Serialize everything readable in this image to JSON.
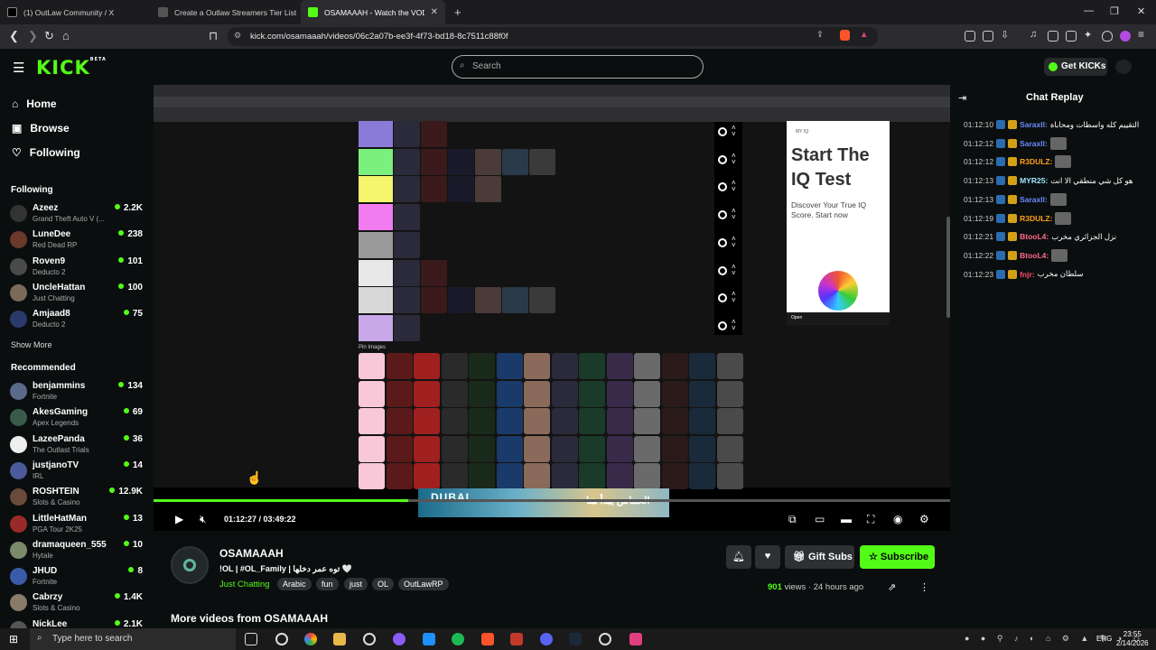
{
  "browser": {
    "tabs": [
      {
        "label": "(1) OutLaw Community / X",
        "fav": "#000000"
      },
      {
        "label": "Create a Outlaw Streamers Tier List -",
        "fav": "#555555"
      },
      {
        "label": "OSAMAAAH - Watch the VOD o",
        "fav": "#53fc18"
      }
    ],
    "new_tab": "+",
    "url": "kick.com/osamaaah/videos/06c2a07b-ee3f-4f73-bd18-8c7511c88f0f"
  },
  "header": {
    "logo": "KICK",
    "logo_badge": "BETA",
    "search_placeholder": "Search",
    "get_kicks": "Get KICKs"
  },
  "sidebar": {
    "nav": [
      {
        "label": "Home",
        "icon": "home-icon"
      },
      {
        "label": "Browse",
        "icon": "browse-icon"
      },
      {
        "label": "Following",
        "icon": "heart-icon"
      }
    ],
    "following_title": "Following",
    "following": [
      {
        "name": "Azeez",
        "game": "Grand Theft Auto V (...",
        "viewers": "2.2K",
        "color": "#333"
      },
      {
        "name": "LuneDee",
        "game": "Red Dead RP",
        "viewers": "238",
        "color": "#6b3a2a"
      },
      {
        "name": "Roven9",
        "game": "Deducto 2",
        "viewers": "101",
        "color": "#4a4a4a"
      },
      {
        "name": "UncleHattan",
        "game": "Just Chatting",
        "viewers": "100",
        "color": "#7b6a5a"
      },
      {
        "name": "Amjaad8",
        "game": "Deducto 2",
        "viewers": "75",
        "color": "#2a3a6b"
      }
    ],
    "show_more": "Show More",
    "recommended_title": "Recommended",
    "recommended": [
      {
        "name": "benjammins",
        "game": "Fortnite",
        "viewers": "134",
        "color": "#5a6a8a"
      },
      {
        "name": "AkesGaming",
        "game": "Apex Legends",
        "viewers": "69",
        "color": "#3a5a4a"
      },
      {
        "name": "LazeePanda",
        "game": "The Outlast Trials",
        "viewers": "36",
        "color": "#eeeeee"
      },
      {
        "name": "justjanoTV",
        "game": "IRL",
        "viewers": "14",
        "color": "#4a5a9a"
      },
      {
        "name": "ROSHTEIN",
        "game": "Slots & Casino",
        "viewers": "12.9K",
        "color": "#6a4a3a"
      },
      {
        "name": "LittleHatMan",
        "game": "PGA Tour 2K25",
        "viewers": "13",
        "color": "#9a2a2a"
      },
      {
        "name": "dramaqueen_555",
        "game": "Hytale",
        "viewers": "10",
        "color": "#7a8a6a"
      },
      {
        "name": "JHUD",
        "game": "Fortnite",
        "viewers": "8",
        "color": "#3a5aaa"
      },
      {
        "name": "Cabrzy",
        "game": "Slots & Casino",
        "viewers": "1.4K",
        "color": "#8a7a6a"
      },
      {
        "name": "NickLee",
        "game": "",
        "viewers": "2.1K",
        "color": "#555"
      }
    ]
  },
  "player": {
    "time": "01:12:27 / 03:49:22",
    "progress_fraction": 0.32,
    "banner_text": "الحماس يبدأ هنا",
    "banner_brand": "DUBAI",
    "ad_brand": "MY IQ",
    "ad_title": "Start The IQ Test",
    "ad_body": "Discover Your True IQ Score. Start now",
    "ad_open": "Open",
    "pin_images_label": "Pin Images",
    "tier_colors": [
      "#8b7bd8",
      "#7cf07c",
      "#f5f56e",
      "#f07cf0",
      "#9a9a9a",
      "#e8e8e8",
      "#d8d8d8",
      "#c8a8e8"
    ]
  },
  "stream": {
    "channel": "OSAMAAAH",
    "subtitle": "!OL | #OL_Family | توه عمر دخلها 🤍",
    "category": "Just Chatting",
    "tags": [
      "Arabic",
      "fun",
      "just",
      "OL",
      "OutLawRP"
    ],
    "views_count": "901",
    "views_label": "views",
    "age": "24 hours ago",
    "gift_subs": "Gift Subs",
    "subscribe": "Subscribe",
    "more_videos": "More videos from OSAMAAAH"
  },
  "chat": {
    "title": "Chat Replay",
    "messages": [
      {
        "ts": "01:12:10",
        "user": "Saraxll",
        "user_color": "#6b8cff",
        "text": "التقييم كله واسطات ومحاباة",
        "emote": false
      },
      {
        "ts": "01:12:12",
        "user": "Saraxll",
        "user_color": "#6b8cff",
        "text": "",
        "emote": true
      },
      {
        "ts": "01:12:12",
        "user": "R3DULZ",
        "user_color": "#ff9f1a",
        "text": "",
        "emote": true
      },
      {
        "ts": "01:12:13",
        "user": "MYR25",
        "user_color": "#9fe6ff",
        "text": "هو كل شي منطقي الا انت",
        "emote": false
      },
      {
        "ts": "01:12:13",
        "user": "Saraxll",
        "user_color": "#6b8cff",
        "text": "",
        "emote": true
      },
      {
        "ts": "01:12:19",
        "user": "R3DULZ",
        "user_color": "#ff9f1a",
        "text": "",
        "emote": true
      },
      {
        "ts": "01:12:21",
        "user": "BtooL4",
        "user_color": "#ff6b8a",
        "text": "نزل الجزائري مخرب",
        "emote": false
      },
      {
        "ts": "01:12:22",
        "user": "BtooL4",
        "user_color": "#ff6b8a",
        "text": "",
        "emote": true
      },
      {
        "ts": "01:12:23",
        "user": "fnjr",
        "user_color": "#ff4a6a",
        "text": "سلطان مخرب",
        "emote": false
      }
    ]
  },
  "taskbar": {
    "search_placeholder": "Type here to search",
    "lang": "ENG",
    "time": "23:55",
    "date": "2/14/2026"
  },
  "colors": {
    "accent": "#53fc18",
    "background": "#0b0e0f"
  }
}
